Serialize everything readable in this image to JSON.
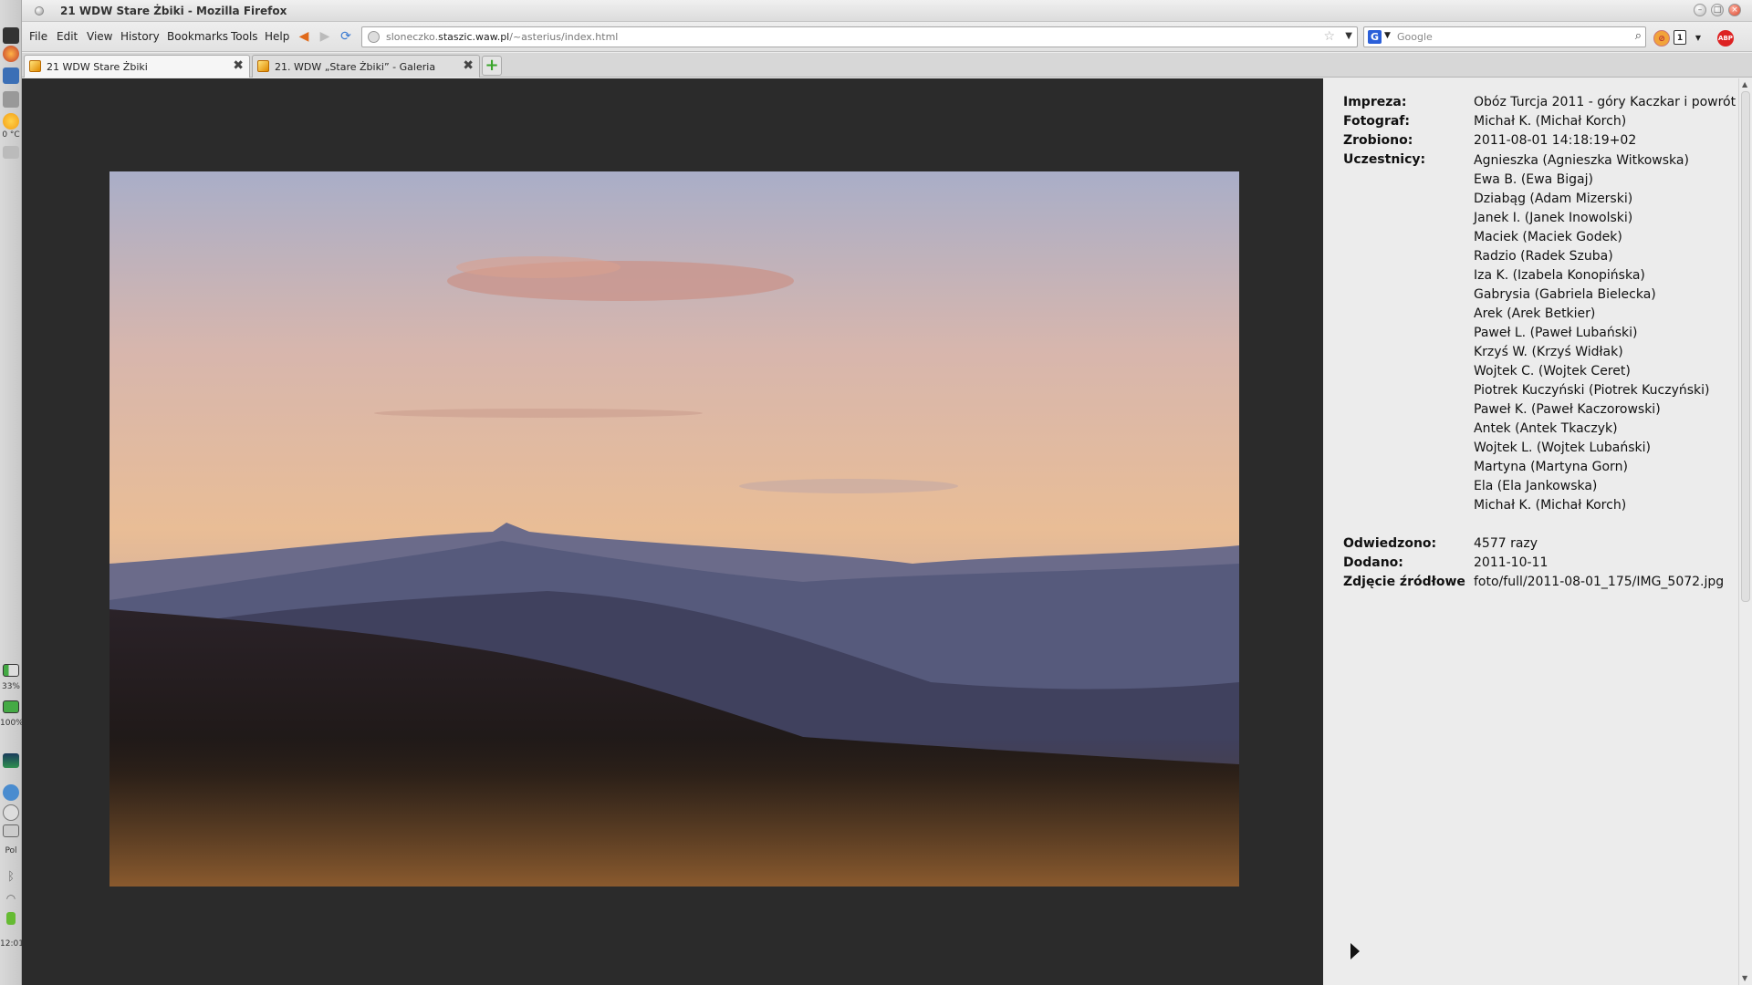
{
  "window": {
    "title": "21 WDW Stare Żbiki - Mozilla Firefox"
  },
  "side_panel": {
    "temperature": "0 °C",
    "battery1": "33%",
    "battery2": "100%",
    "keyboard": "Pol",
    "clock": "12:01"
  },
  "menu": {
    "file": "File",
    "edit": "Edit",
    "view": "View",
    "history": "History",
    "bookmarks": "Bookmarks",
    "tools": "Tools",
    "help": "Help"
  },
  "urlbar": {
    "prefix": "sloneczko.",
    "domain": "staszic.waw.pl",
    "path": "/~asterius/index.html"
  },
  "search": {
    "placeholder": "Google",
    "engine_letter": "G"
  },
  "addons": {
    "counter": "1",
    "adblock": "ABP"
  },
  "tabs": [
    {
      "label": "21 WDW Stare Żbiki",
      "active": true
    },
    {
      "label": "21. WDW „Stare Żbiki” - Galeria",
      "active": false
    }
  ],
  "info": {
    "event_label": "Impreza:",
    "event_value": "Obóz Turcja 2011 - góry Kaczkar i powrót",
    "photographer_label": "Fotograf:",
    "photographer_value": "Michał K. (Michał Korch)",
    "taken_label": "Zrobiono:",
    "taken_value": "2011-08-01 14:18:19+02",
    "participants_label": "Uczestnicy:",
    "participants": [
      "Agnieszka (Agnieszka Witkowska)",
      "Ewa B. (Ewa Bigaj)",
      "Dziabąg (Adam Mizerski)",
      "Janek I. (Janek Inowolski)",
      "Maciek (Maciek Godek)",
      "Radzio (Radek Szuba)",
      "Iza K. (Izabela Konopińska)",
      "Gabrysia (Gabriela Bielecka)",
      "Arek (Arek Betkier)",
      "Paweł L. (Paweł Lubański)",
      "Krzyś W. (Krzyś Widłak)",
      "Wojtek C. (Wojtek Ceret)",
      "Piotrek Kuczyński (Piotrek Kuczyński)",
      "Paweł K. (Paweł Kaczorowski)",
      "Antek (Antek Tkaczyk)",
      "Wojtek L. (Wojtek Lubański)",
      "Martyna (Martyna Gorn)",
      "Ela (Ela Jankowska)",
      "Michał K. (Michał Korch)"
    ],
    "visited_label": "Odwiedzono:",
    "visited_value": "4577 razy",
    "added_label": "Dodano:",
    "added_value": "2011-10-11",
    "source_label": "Zdjęcie źródłowe",
    "source_value": "foto/full/2011-08-01_175/IMG_5072.jpg"
  }
}
